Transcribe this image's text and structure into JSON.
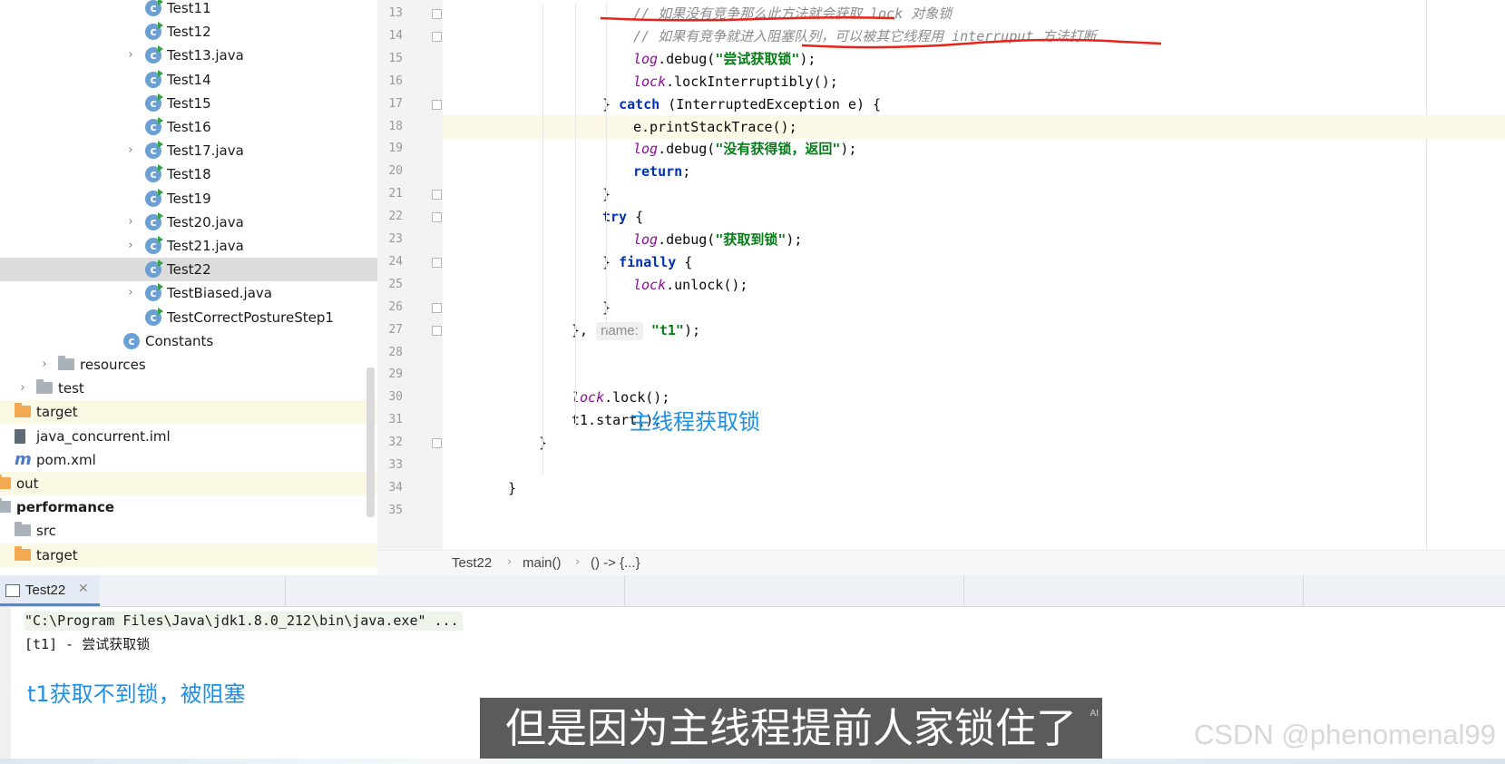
{
  "project_tree": {
    "items": [
      {
        "label": "Test11",
        "kind": "class"
      },
      {
        "label": "Test12",
        "kind": "class"
      },
      {
        "label": "Test13.java",
        "kind": "class",
        "expandable": true
      },
      {
        "label": "Test14",
        "kind": "class"
      },
      {
        "label": "Test15",
        "kind": "class"
      },
      {
        "label": "Test16",
        "kind": "class"
      },
      {
        "label": "Test17.java",
        "kind": "class",
        "expandable": true
      },
      {
        "label": "Test18",
        "kind": "class"
      },
      {
        "label": "Test19",
        "kind": "class"
      },
      {
        "label": "Test20.java",
        "kind": "class",
        "expandable": true
      },
      {
        "label": "Test21.java",
        "kind": "class",
        "expandable": true
      },
      {
        "label": "Test22",
        "kind": "class",
        "selected": true
      },
      {
        "label": "TestBiased.java",
        "kind": "class",
        "expandable": true
      },
      {
        "label": "TestCorrectPostureStep1",
        "kind": "class"
      },
      {
        "label": "Constants",
        "kind": "class-plain"
      },
      {
        "label": "resources",
        "kind": "folder",
        "expandable": true
      },
      {
        "label": "test",
        "kind": "folder",
        "expandable": true
      },
      {
        "label": "target",
        "kind": "folder-orange"
      },
      {
        "label": "java_concurrent.iml",
        "kind": "iml"
      },
      {
        "label": "pom.xml",
        "kind": "maven"
      },
      {
        "label": "out",
        "kind": "folder-orange"
      },
      {
        "label": "performance",
        "kind": "module"
      },
      {
        "label": "src",
        "kind": "folder"
      },
      {
        "label": "target",
        "kind": "folder-orange"
      }
    ]
  },
  "editor": {
    "line_numbers": [
      "13",
      "14",
      "15",
      "16",
      "17",
      "18",
      "19",
      "20",
      "21",
      "22",
      "23",
      "24",
      "25",
      "26",
      "27",
      "28",
      "29",
      "30",
      "31",
      "32",
      "33",
      "34",
      "35"
    ],
    "lines": [
      [
        {
          "t": "// 如果没有竞争那么此方法就会获取 lock 对象锁",
          "c": "cm"
        }
      ],
      [
        {
          "t": "// 如果有竞争就进入阻塞队列，可以被其它线程用 interruput 方法打断",
          "c": "cm"
        }
      ],
      [
        {
          "t": "log",
          "c": "fld"
        },
        {
          "t": ".debug("
        },
        {
          "t": "\"尝试获取锁\"",
          "c": "st"
        },
        {
          "t": ");"
        }
      ],
      [
        {
          "t": "lock",
          "c": "fld"
        },
        {
          "t": ".lockInterruptibly();"
        }
      ],
      [
        {
          "t": "} "
        },
        {
          "t": "catch",
          "c": "kw"
        },
        {
          "t": " (InterruptedException e) {"
        }
      ],
      [
        {
          "t": "e.printStackTrace();"
        }
      ],
      [
        {
          "t": "log",
          "c": "fld"
        },
        {
          "t": ".debug("
        },
        {
          "t": "\"没有获得锁，返回\"",
          "c": "st"
        },
        {
          "t": ");"
        }
      ],
      [
        {
          "t": "return",
          "c": "kw"
        },
        {
          "t": ";"
        }
      ],
      [
        {
          "t": "}"
        }
      ],
      [
        {
          "t": "try",
          "c": "kw"
        },
        {
          "t": " {"
        }
      ],
      [
        {
          "t": "log",
          "c": "fld"
        },
        {
          "t": ".debug("
        },
        {
          "t": "\"获取到锁\"",
          "c": "st"
        },
        {
          "t": ");"
        }
      ],
      [
        {
          "t": "} "
        },
        {
          "t": "finally",
          "c": "kw"
        },
        {
          "t": " {"
        }
      ],
      [
        {
          "t": "lock",
          "c": "fld"
        },
        {
          "t": ".unlock();"
        }
      ],
      [
        {
          "t": "}"
        }
      ],
      [
        {
          "t": "}, "
        },
        {
          "t": "name:",
          "c": "hint"
        },
        {
          "t": " "
        },
        {
          "t": "\"t1\"",
          "c": "st"
        },
        {
          "t": ");"
        }
      ],
      [],
      [],
      [
        {
          "t": "lock",
          "c": "fld"
        },
        {
          "t": ".lock();"
        }
      ],
      [
        {
          "t": "t1.start();"
        }
      ],
      [
        {
          "t": "}"
        }
      ],
      [],
      [
        {
          "t": "}"
        }
      ],
      []
    ],
    "current_line": "18",
    "annotation": "主线程获取锁"
  },
  "breadcrumb": [
    "Test22",
    "main()",
    "() -> {...}"
  ],
  "run_panel": {
    "tab_label": "Test22",
    "console_lines": [
      "\"C:\\Program Files\\Java\\jdk1.8.0_212\\bin\\java.exe\" ...",
      "[t1] - 尝试获取锁"
    ],
    "annotation": "t1获取不到锁，被阻塞"
  },
  "subtitle": "但是因为主线程提前人家锁住了",
  "subtitle_badge": "AI",
  "watermark": "CSDN @phenomenal99",
  "colors": {
    "keyword": "#0033b3",
    "string": "#067d17",
    "field": "#871094",
    "comment": "#8c8c8c",
    "annotation": "#1e8fe6",
    "underline": "#e8231a"
  }
}
